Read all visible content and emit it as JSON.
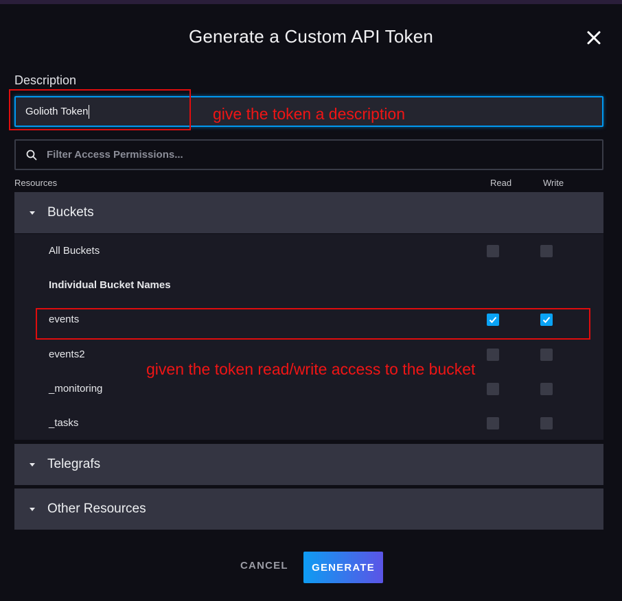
{
  "dialog": {
    "title": "Generate a Custom API Token",
    "description_label": "Description",
    "description_value": "Golioth Token",
    "filter_placeholder": "Filter Access Permissions..."
  },
  "columns": {
    "resources": "Resources",
    "read": "Read",
    "write": "Write"
  },
  "sections": {
    "buckets": {
      "label": "Buckets",
      "all_label": "All Buckets",
      "individual_heading": "Individual Bucket Names",
      "rows": [
        {
          "name": "events",
          "read": true,
          "write": true
        },
        {
          "name": "events2",
          "read": false,
          "write": false
        },
        {
          "name": "_monitoring",
          "read": false,
          "write": false
        },
        {
          "name": "_tasks",
          "read": false,
          "write": false
        }
      ]
    },
    "telegrafs": {
      "label": "Telegrafs"
    },
    "other": {
      "label": "Other Resources"
    }
  },
  "annotations": {
    "description_note": "give the token a description",
    "access_note": "given the token read/write access to the bucket"
  },
  "actions": {
    "cancel": "CANCEL",
    "generate": "GENERATE"
  },
  "colors": {
    "accent": "#0aa3f5",
    "annotation": "#e00d0d",
    "panel": "#343542"
  }
}
